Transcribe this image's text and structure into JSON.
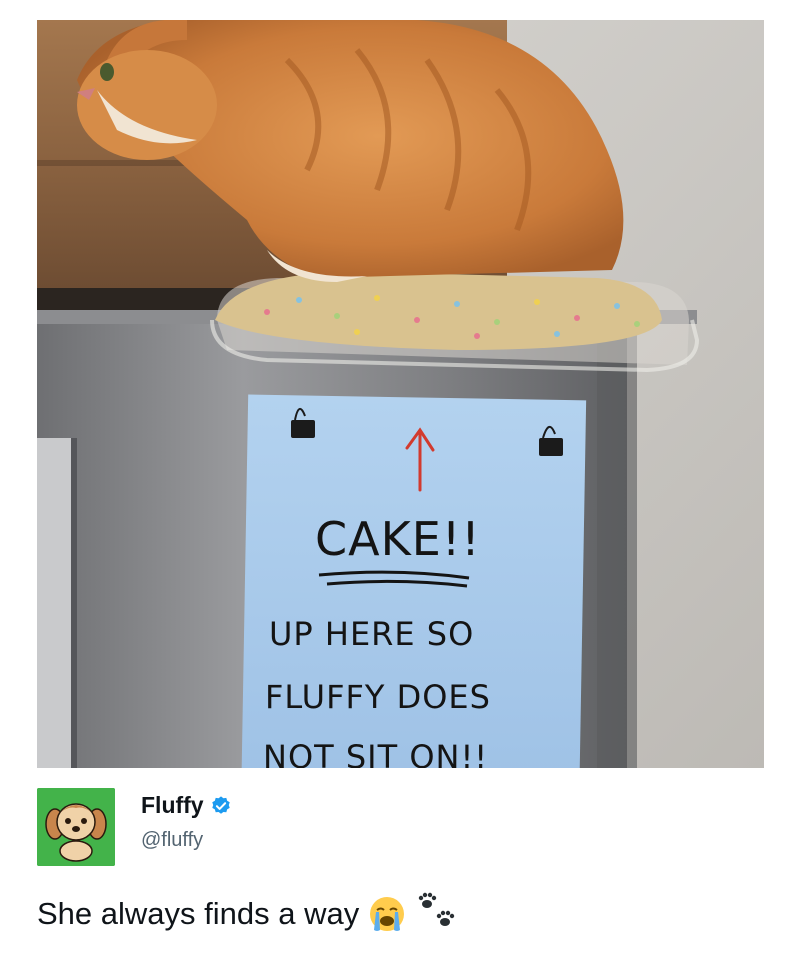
{
  "post": {
    "image": {
      "sign": {
        "arrow": "↑",
        "line1": "CAKE!!",
        "line2": "UP HERE SO",
        "line3": "FLUFFY DOES",
        "line4": "NOT SIT ON!!"
      }
    },
    "author": {
      "display_name": "Fluffy",
      "handle": "@fluffy",
      "verified_icon": "verified-badge-icon",
      "avatar_icon": "dog-avatar-icon"
    },
    "text": "She always finds a way",
    "emoji": [
      "loudly-crying-face-icon",
      "paw-prints-icon"
    ]
  },
  "colors": {
    "verified": "#1d9bf0",
    "avatar_bg": "#43b34a",
    "sign_paper": "#a7c9ea",
    "arrow": "#d23a2e",
    "cat": "#d88a45"
  }
}
